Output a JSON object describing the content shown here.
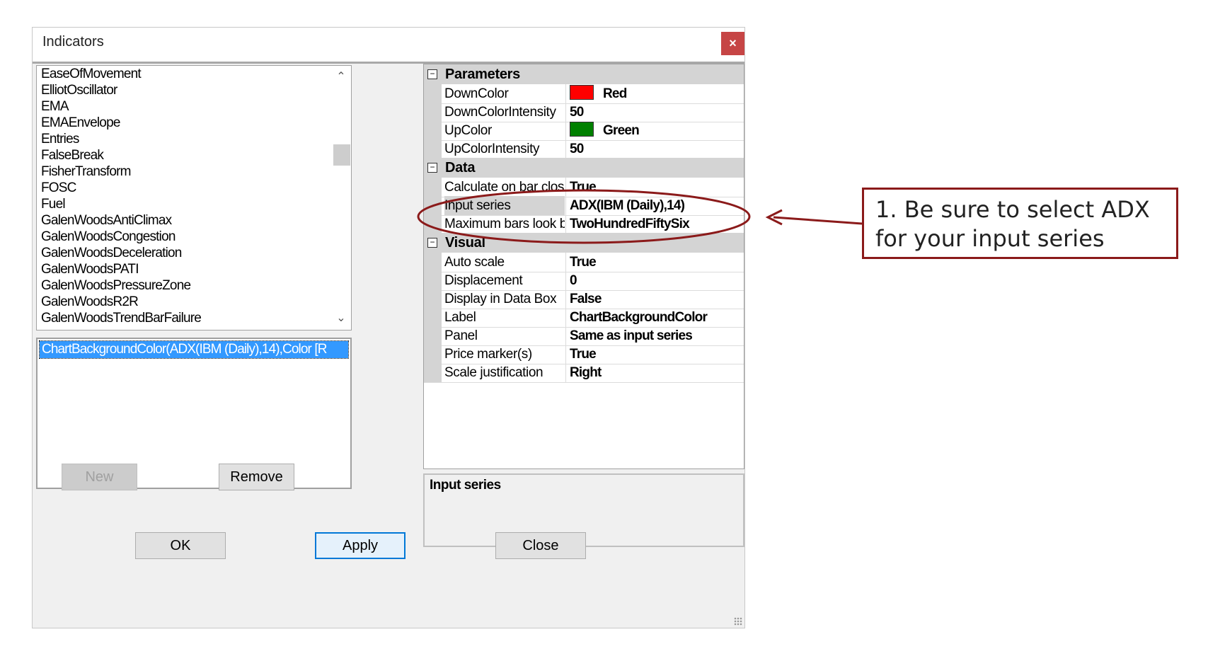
{
  "window": {
    "title": "Indicators",
    "close_symbol": "×"
  },
  "indicator_list": {
    "items": [
      "EaseOfMovement",
      "ElliotOscillator",
      "EMA",
      "EMAEnvelope",
      "Entries",
      "FalseBreak",
      "FisherTransform",
      "FOSC",
      "Fuel",
      "GalenWoodsAntiClimax",
      "GalenWoodsCongestion",
      "GalenWoodsDeceleration",
      "GalenWoodsPATI",
      "GalenWoodsPressureZone",
      "GalenWoodsR2R",
      "GalenWoodsTrendBarFailure"
    ],
    "scroll_up": "⌃",
    "scroll_down": "⌄"
  },
  "applied_list": {
    "items": [
      "ChartBackgroundColor(ADX(IBM (Daily),14),Color [R"
    ]
  },
  "list_buttons": {
    "new_label": "New",
    "remove_label": "Remove"
  },
  "property_grid": {
    "categories": [
      {
        "label": "Parameters",
        "properties": [
          {
            "name": "DownColor",
            "value": "Red",
            "swatch": "#ff0000"
          },
          {
            "name": "DownColorIntensity",
            "value": "50"
          },
          {
            "name": "UpColor",
            "value": "Green",
            "swatch": "#008000"
          },
          {
            "name": "UpColorIntensity",
            "value": "50"
          }
        ]
      },
      {
        "label": "Data",
        "properties": [
          {
            "name": "Calculate on bar clos",
            "value": "True"
          },
          {
            "name": "Input series",
            "value": "ADX(IBM (Daily),14)",
            "selected": true
          },
          {
            "name": "Maximum bars look b",
            "value": "TwoHundredFiftySix"
          }
        ]
      },
      {
        "label": "Visual",
        "properties": [
          {
            "name": "Auto scale",
            "value": "True"
          },
          {
            "name": "Displacement",
            "value": "0"
          },
          {
            "name": "Display in Data Box",
            "value": "False"
          },
          {
            "name": "Label",
            "value": "ChartBackgroundColor"
          },
          {
            "name": "Panel",
            "value": "Same as input series"
          },
          {
            "name": "Price marker(s)",
            "value": "True"
          },
          {
            "name": "Scale justification",
            "value": "Right"
          }
        ]
      }
    ],
    "collapse_symbol": "−"
  },
  "description": {
    "title": "Input series"
  },
  "dialog_buttons": {
    "ok_label": "OK",
    "apply_label": "Apply",
    "close_label": "Close"
  },
  "annotation": {
    "text": "1. Be sure to select ADX for your input series",
    "color": "#8b1a1a"
  },
  "colors": {
    "selection": "#3399ff",
    "category_bg": "#d4d4d4",
    "accent_border": "#0078d7"
  }
}
